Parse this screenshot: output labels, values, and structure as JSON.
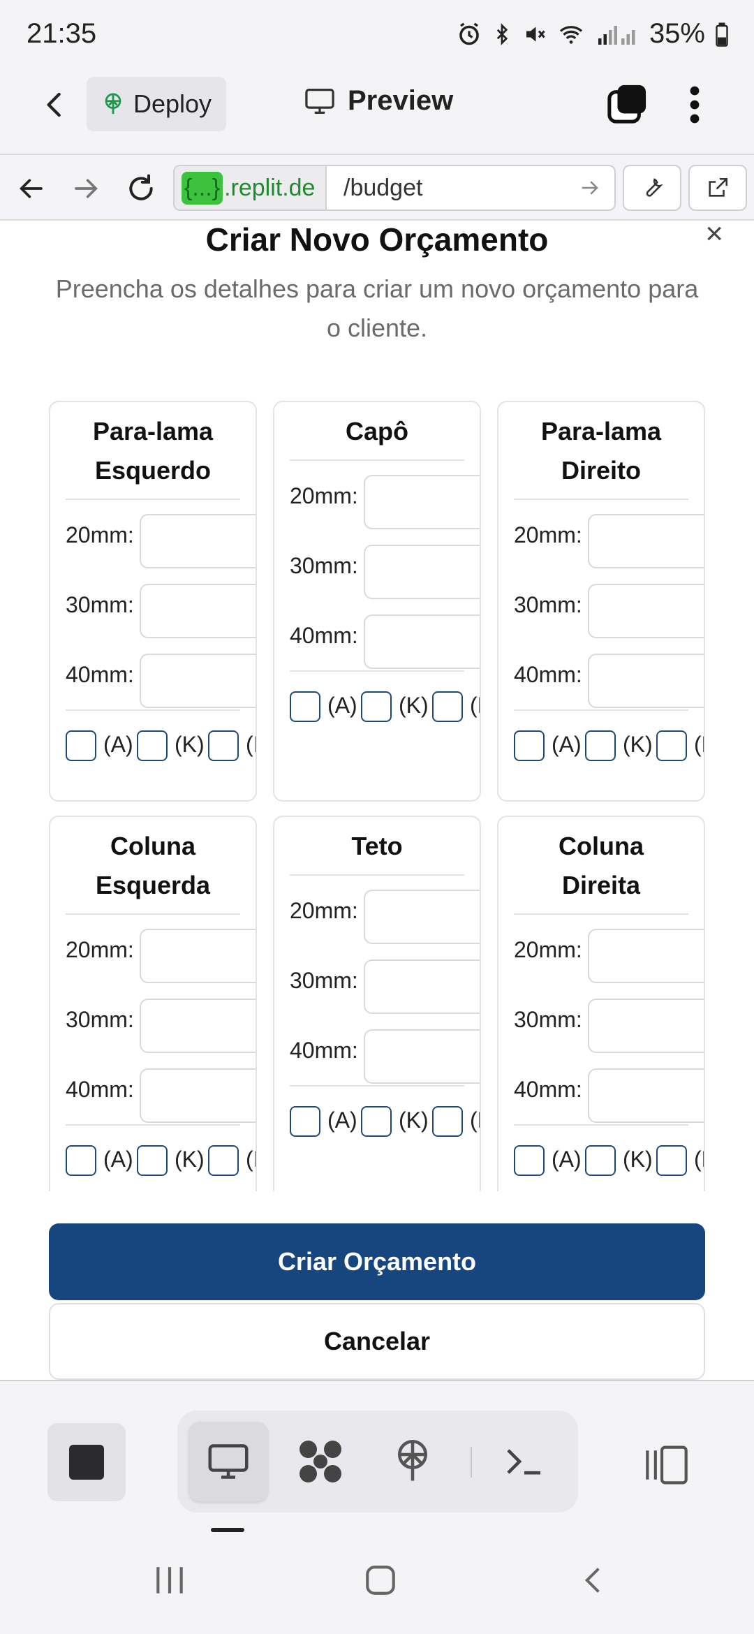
{
  "status_bar": {
    "time": "21:35",
    "battery": "35%"
  },
  "app_header": {
    "deploy_label": "Deploy",
    "preview_label": "Preview"
  },
  "browser": {
    "domain_badge": "{...}",
    "domain_text": ".replit.de",
    "path": "/budget"
  },
  "dialog": {
    "title": "Criar Novo Orçamento",
    "description": "Preencha os detalhes para criar um novo orçamento para o cliente.",
    "sizes": [
      "20mm:",
      "30mm:",
      "40mm:"
    ],
    "options": [
      "(A)",
      "(K)",
      "(P)"
    ],
    "cards": [
      {
        "title": "Para-lama Esquerdo"
      },
      {
        "title": "Capô"
      },
      {
        "title": "Para-lama Direito"
      },
      {
        "title": "Coluna Esquerda"
      },
      {
        "title": "Teto"
      },
      {
        "title": "Coluna Direita"
      }
    ],
    "submit_label": "Criar Orçamento",
    "cancel_label": "Cancelar"
  },
  "colors": {
    "primary": "#16467d",
    "checkbox_border": "#1f4a78",
    "domain_green": "#1f8a2e"
  }
}
